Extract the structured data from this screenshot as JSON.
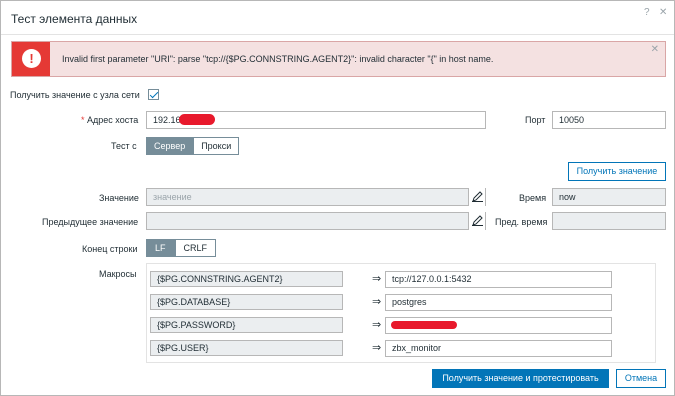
{
  "dialog": {
    "title": "Тест элемента данных",
    "help_label": "?",
    "close_label": "✕"
  },
  "error": {
    "icon": "!",
    "message": "Invalid first parameter \"URI\": parse \"tcp://{$PG.CONNSTRING.AGENT2}\": invalid character \"{\" in host name.",
    "close_label": "✕"
  },
  "form": {
    "get_from_host_label": "Получить значение с узла сети",
    "get_from_host_checked": true,
    "host_address_label": "Адрес хоста",
    "host_address_required": "*",
    "host_address_value": "192.168.",
    "port_label": "Порт",
    "port_value": "10050",
    "test_with_label": "Тест с",
    "test_with_options": [
      "Сервер",
      "Прокси"
    ],
    "test_with_selected": "Сервер",
    "get_value_button": "Получить значение",
    "value_label": "Значение",
    "value_placeholder": "значение",
    "time_label": "Время",
    "time_value": "now",
    "prev_value_label": "Предыдущее значение",
    "prev_time_label": "Пред. время",
    "eol_label": "Конец строки",
    "eol_options": [
      "LF",
      "CRLF"
    ],
    "eol_selected": "LF",
    "macros_label": "Макросы"
  },
  "macros": [
    {
      "name": "{$PG.CONNSTRING.AGENT2}",
      "arrow": "⇒",
      "value": "tcp://127.0.0.1:5432"
    },
    {
      "name": "{$PG.DATABASE}",
      "arrow": "⇒",
      "value": "postgres"
    },
    {
      "name": "{$PG.PASSWORD}",
      "arrow": "⇒",
      "value": ""
    },
    {
      "name": "{$PG.USER}",
      "arrow": "⇒",
      "value": "zbx_monitor"
    }
  ],
  "footer": {
    "primary_button": "Получить значение и протестировать",
    "cancel_button": "Отмена"
  },
  "colors": {
    "accent": "#0275b8",
    "error": "#e53935",
    "segment_active": "#768d99"
  }
}
